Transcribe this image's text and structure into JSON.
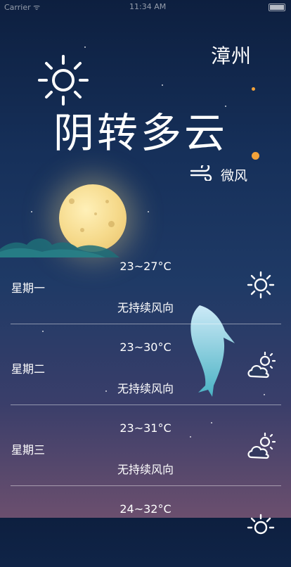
{
  "status_bar": {
    "carrier": "Carrier ᯤ",
    "time": "11:34 AM"
  },
  "header": {
    "city": "漳州",
    "condition": "阴转多云",
    "condition_icon": "sun-icon",
    "wind": "微风",
    "wind_icon": "wind-icon"
  },
  "colors": {
    "accent_orange": "#f2a23a",
    "moon": "#f5d98a"
  },
  "forecast": [
    {
      "day": "星期一",
      "temp": "23~27°C",
      "wind": "无持续风向",
      "icon": "sun-icon"
    },
    {
      "day": "星期二",
      "temp": "23~30°C",
      "wind": "无持续风向",
      "icon": "cloud-sun-icon"
    },
    {
      "day": "星期三",
      "temp": "23~31°C",
      "wind": "无持续风向",
      "icon": "cloud-sun-icon"
    },
    {
      "day": "",
      "temp": "24~32°C",
      "wind": "",
      "icon": "sun-icon"
    }
  ]
}
